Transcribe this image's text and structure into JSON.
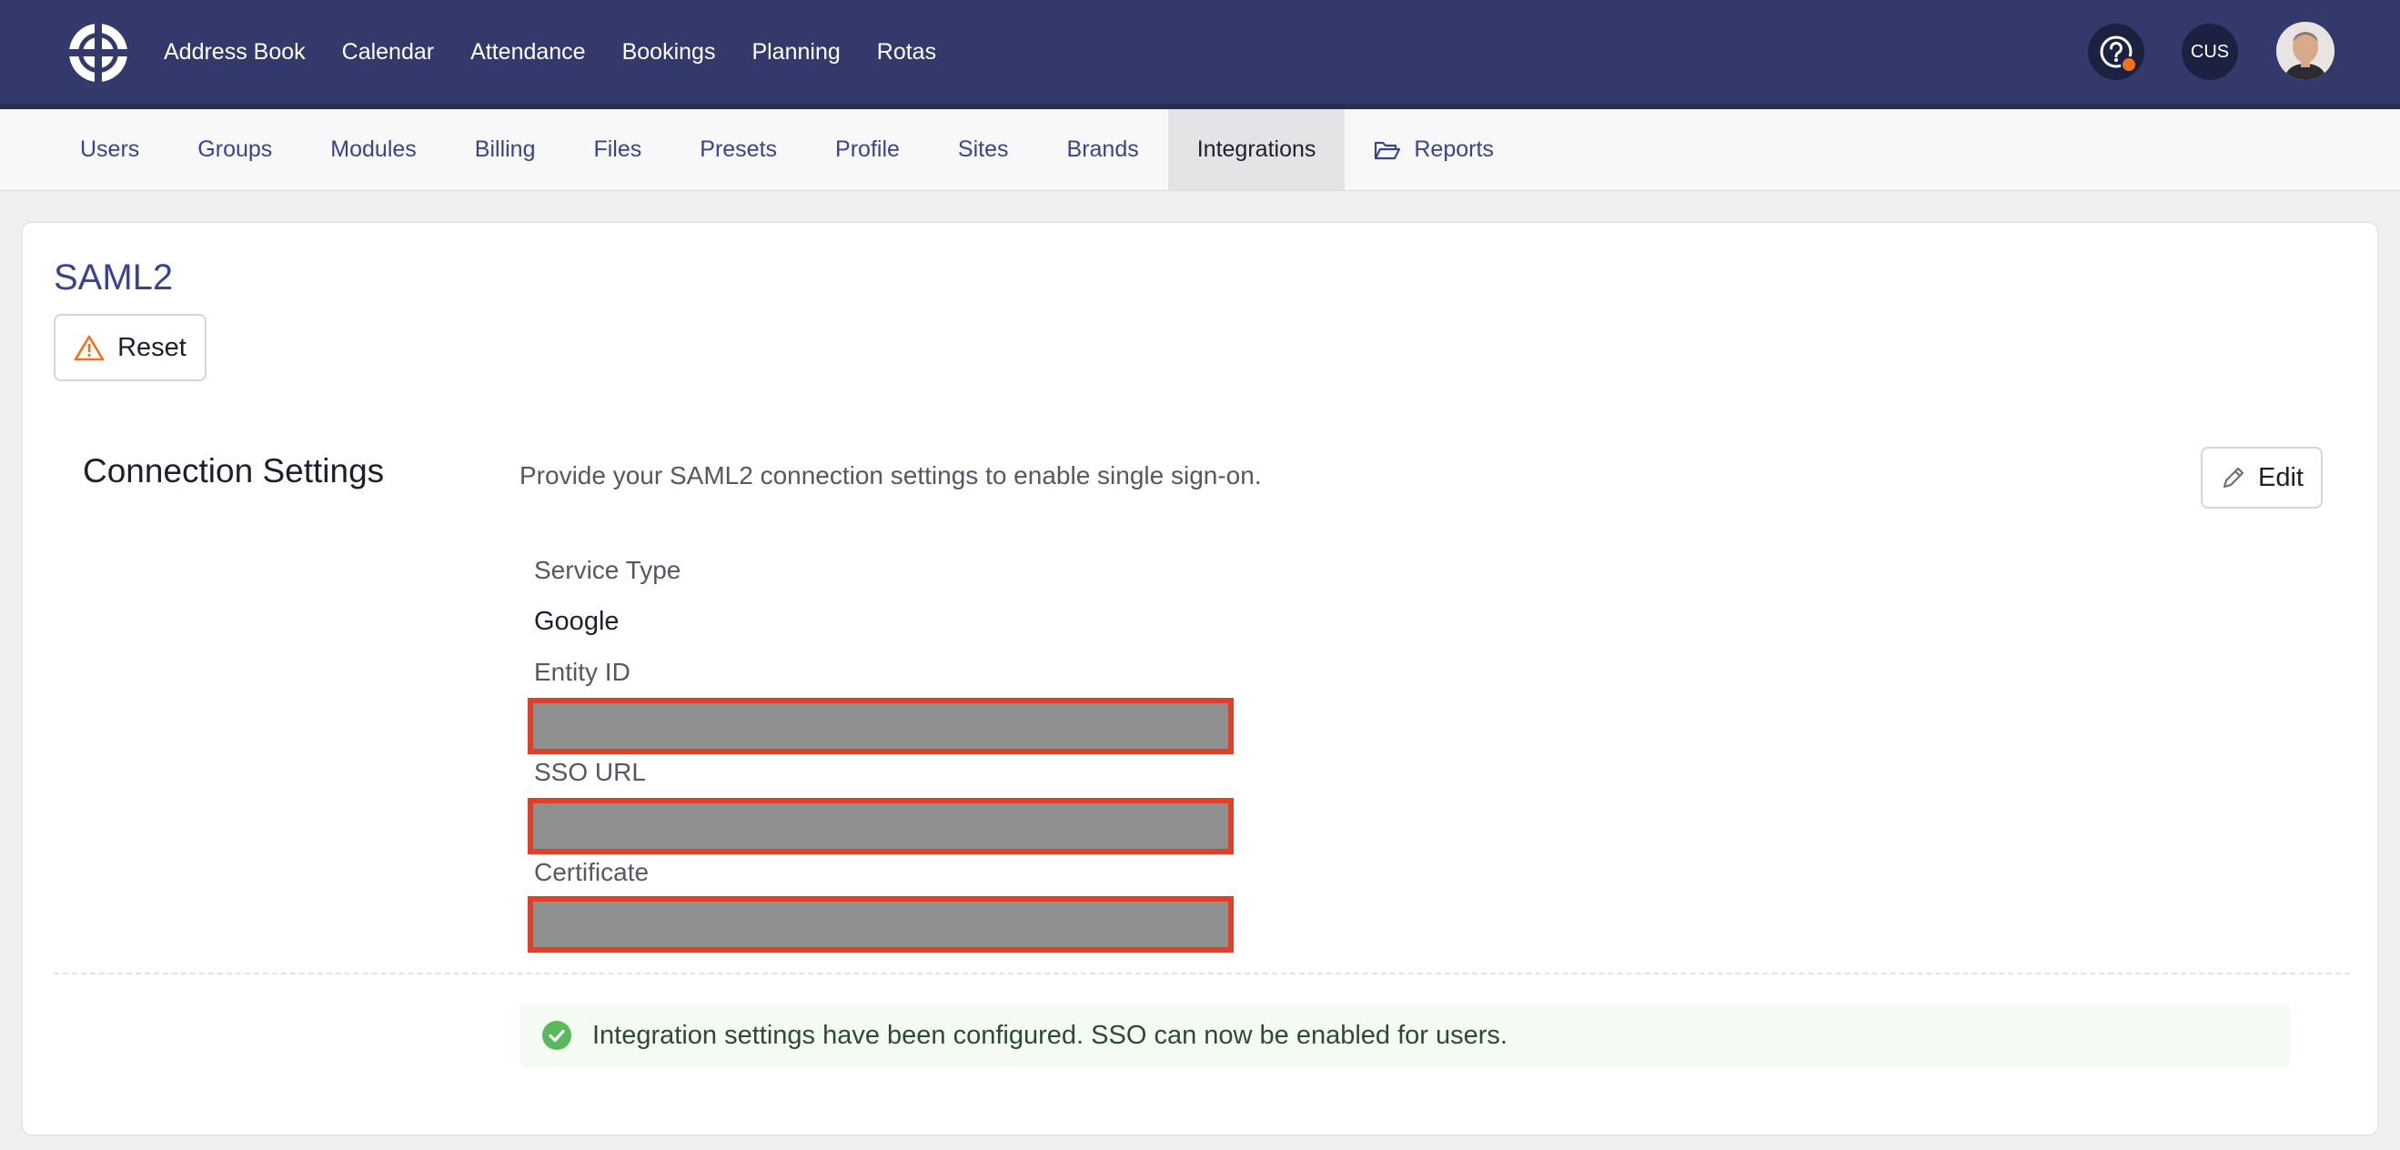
{
  "topbar": {
    "nav": [
      "Address Book",
      "Calendar",
      "Attendance",
      "Bookings",
      "Planning",
      "Rotas"
    ],
    "help_icon": "question-circle-icon",
    "account_initials": "CUS",
    "colors": {
      "bar": "#333a6b",
      "notification_dot": "#f2711c"
    }
  },
  "subnav": {
    "tabs": [
      "Users",
      "Groups",
      "Modules",
      "Billing",
      "Files",
      "Presets",
      "Profile",
      "Sites",
      "Brands",
      "Integrations",
      "Reports"
    ],
    "active": "Integrations",
    "reports_icon": "folder-open-icon"
  },
  "page": {
    "title": "SAML2",
    "reset_label": "Reset",
    "reset_icon": "warning-triangle-icon"
  },
  "connection_settings": {
    "title": "Connection Settings",
    "description": "Provide your SAML2 connection settings to enable single sign-on.",
    "edit_label": "Edit",
    "edit_icon": "pencil-icon",
    "fields": {
      "service_type_label": "Service Type",
      "service_type_value": "Google",
      "entity_id_label": "Entity ID",
      "sso_url_label": "SSO URL",
      "certificate_label": "Certificate"
    }
  },
  "status": {
    "message": "Integration settings have been configured. SSO can now be enabled for users.",
    "icon": "check-circle-icon",
    "color": "#5cb85c"
  }
}
